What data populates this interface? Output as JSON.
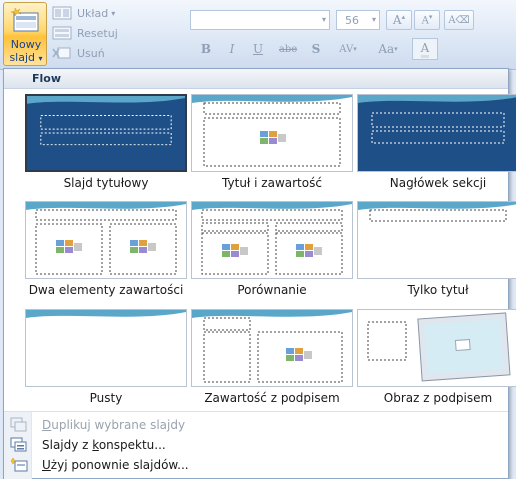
{
  "ribbon": {
    "new_slide": {
      "line1": "Nowy",
      "line2": "slajd"
    },
    "layout": {
      "label": "Układ"
    },
    "reset": {
      "label": "Resetuj"
    },
    "delete": {
      "label": "Usuń"
    },
    "font_size": "56",
    "format_buttons": [
      "B",
      "I",
      "U",
      "abe",
      "S",
      "AV",
      "Aa",
      "A"
    ]
  },
  "dropdown": {
    "section_title": "Flow",
    "layouts": [
      {
        "label": "Slajd tytułowy",
        "selected": true
      },
      {
        "label": "Tytuł i zawartość"
      },
      {
        "label": "Nagłówek sekcji"
      },
      {
        "label": "Dwa elementy zawartości"
      },
      {
        "label": "Porównanie"
      },
      {
        "label": "Tylko tytuł"
      },
      {
        "label": "Pusty"
      },
      {
        "label": "Zawartość z podpisem"
      },
      {
        "label": "Obraz z podpisem"
      }
    ],
    "menu": [
      {
        "pre": "",
        "key": "D",
        "post": "uplikuj wybrane slajdy",
        "disabled": true
      },
      {
        "pre": "Slajdy z ",
        "key": "k",
        "post": "onspektu...",
        "disabled": false
      },
      {
        "pre": "",
        "key": "U",
        "post": "żyj ponownie slajdów...",
        "disabled": false
      }
    ]
  },
  "colors": {
    "accent_blue": "#15428b",
    "slide_dark": "#1e4f86",
    "swoosh": "#5aa7c9",
    "new_slide_highlight": "#ffc13a"
  }
}
